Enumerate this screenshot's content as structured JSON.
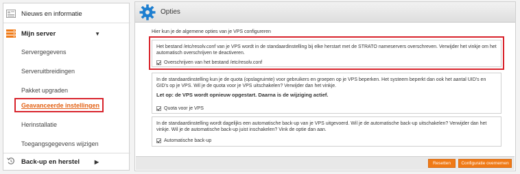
{
  "sidebar": {
    "items": [
      {
        "label": "Nieuws en informatie",
        "icon": "news-icon"
      },
      {
        "label": "Mijn server",
        "icon": "server-icon"
      },
      {
        "label": "Servergegevens"
      },
      {
        "label": "Serveruitbreidingen"
      },
      {
        "label": "Pakket upgraden"
      },
      {
        "label": "Geavanceerde instellingen"
      },
      {
        "label": "Herinstallatie"
      },
      {
        "label": "Toegangsgegevens wijzigen"
      },
      {
        "label": "Back-up en herstel",
        "icon": "backup-icon"
      }
    ],
    "accent": "#e26013",
    "highlight": "#d8222a"
  },
  "main": {
    "title": "Opties",
    "intro": "Hier kun je de algemene opties van je VPS configureren",
    "options": [
      {
        "text": "Het bestand /etc/resolv.conf van je VPS wordt in de standaardinstelling bij elke herstart met de STRATO nameservers overschreven. Verwijder het vinkje om het automatisch overschrijven te deactiveren.",
        "checkbox": "Overschrijven van het bestand /etc/resolv.conf"
      },
      {
        "text": "In de standaardinstelling kun je de quota (opslagruimte) voor gebruikers en groepen op je VPS beperken. Het systeem beperkt dan ook het aantal UID's en GID's op je VPS. Wil je de quota voor je VPS uitschakelen? Verwijder dan het vinkje.",
        "warning": "Let op: de VPS wordt opnieuw opgestart. Daarna is de wijziging actief.",
        "checkbox": "Quota voor je VPS"
      },
      {
        "text": "In de standaardinstelling wordt dagelijks een automatische back-up van je VPS uitgevoerd. Wil je de automatische back-up uitschakelen? Verwijder dan het vinkje. Wil je de automatische back-up juist inschakelen? Vink de optie dan aan.",
        "checkbox": "Automatische back-up"
      }
    ],
    "buttons": {
      "reset": "Resetten",
      "apply": "Configuratie overnemen"
    }
  }
}
